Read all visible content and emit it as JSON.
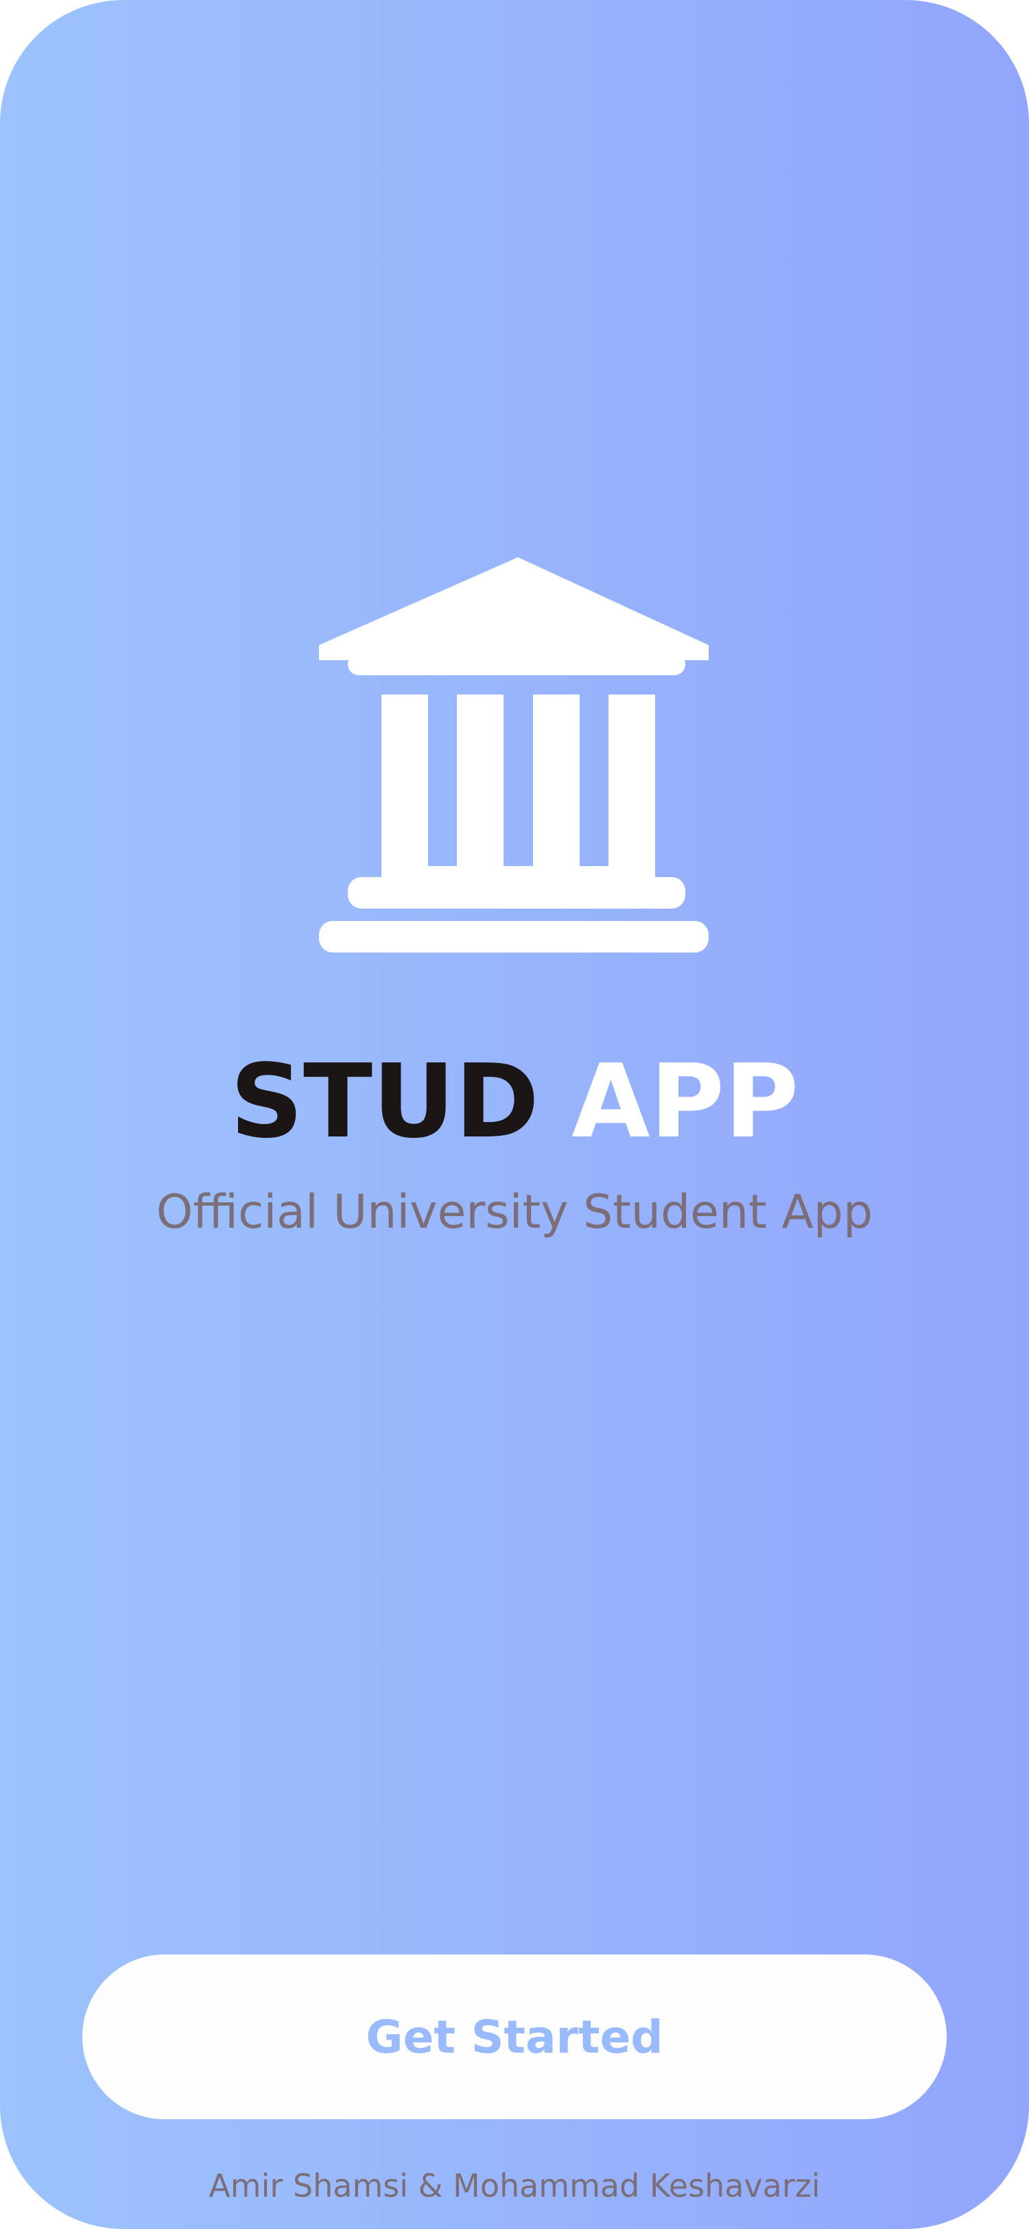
{
  "app": {
    "title_part1": "STUD",
    "title_part2": "APP",
    "subtitle": "Official University Student App",
    "logo_icon": "university-building-icon"
  },
  "actions": {
    "get_started_label": "Get Started"
  },
  "footer": {
    "credits": "Amir Shamsi & Mohammad Keshavarzi"
  },
  "colors": {
    "gradient_start": "#9cc3fd",
    "gradient_end": "#92a5fc",
    "title_dark": "#1b1516",
    "title_light": "#ffffff",
    "muted_text": "#7b6e79",
    "button_background": "#fdfdfd",
    "button_text": "#99bafc"
  }
}
